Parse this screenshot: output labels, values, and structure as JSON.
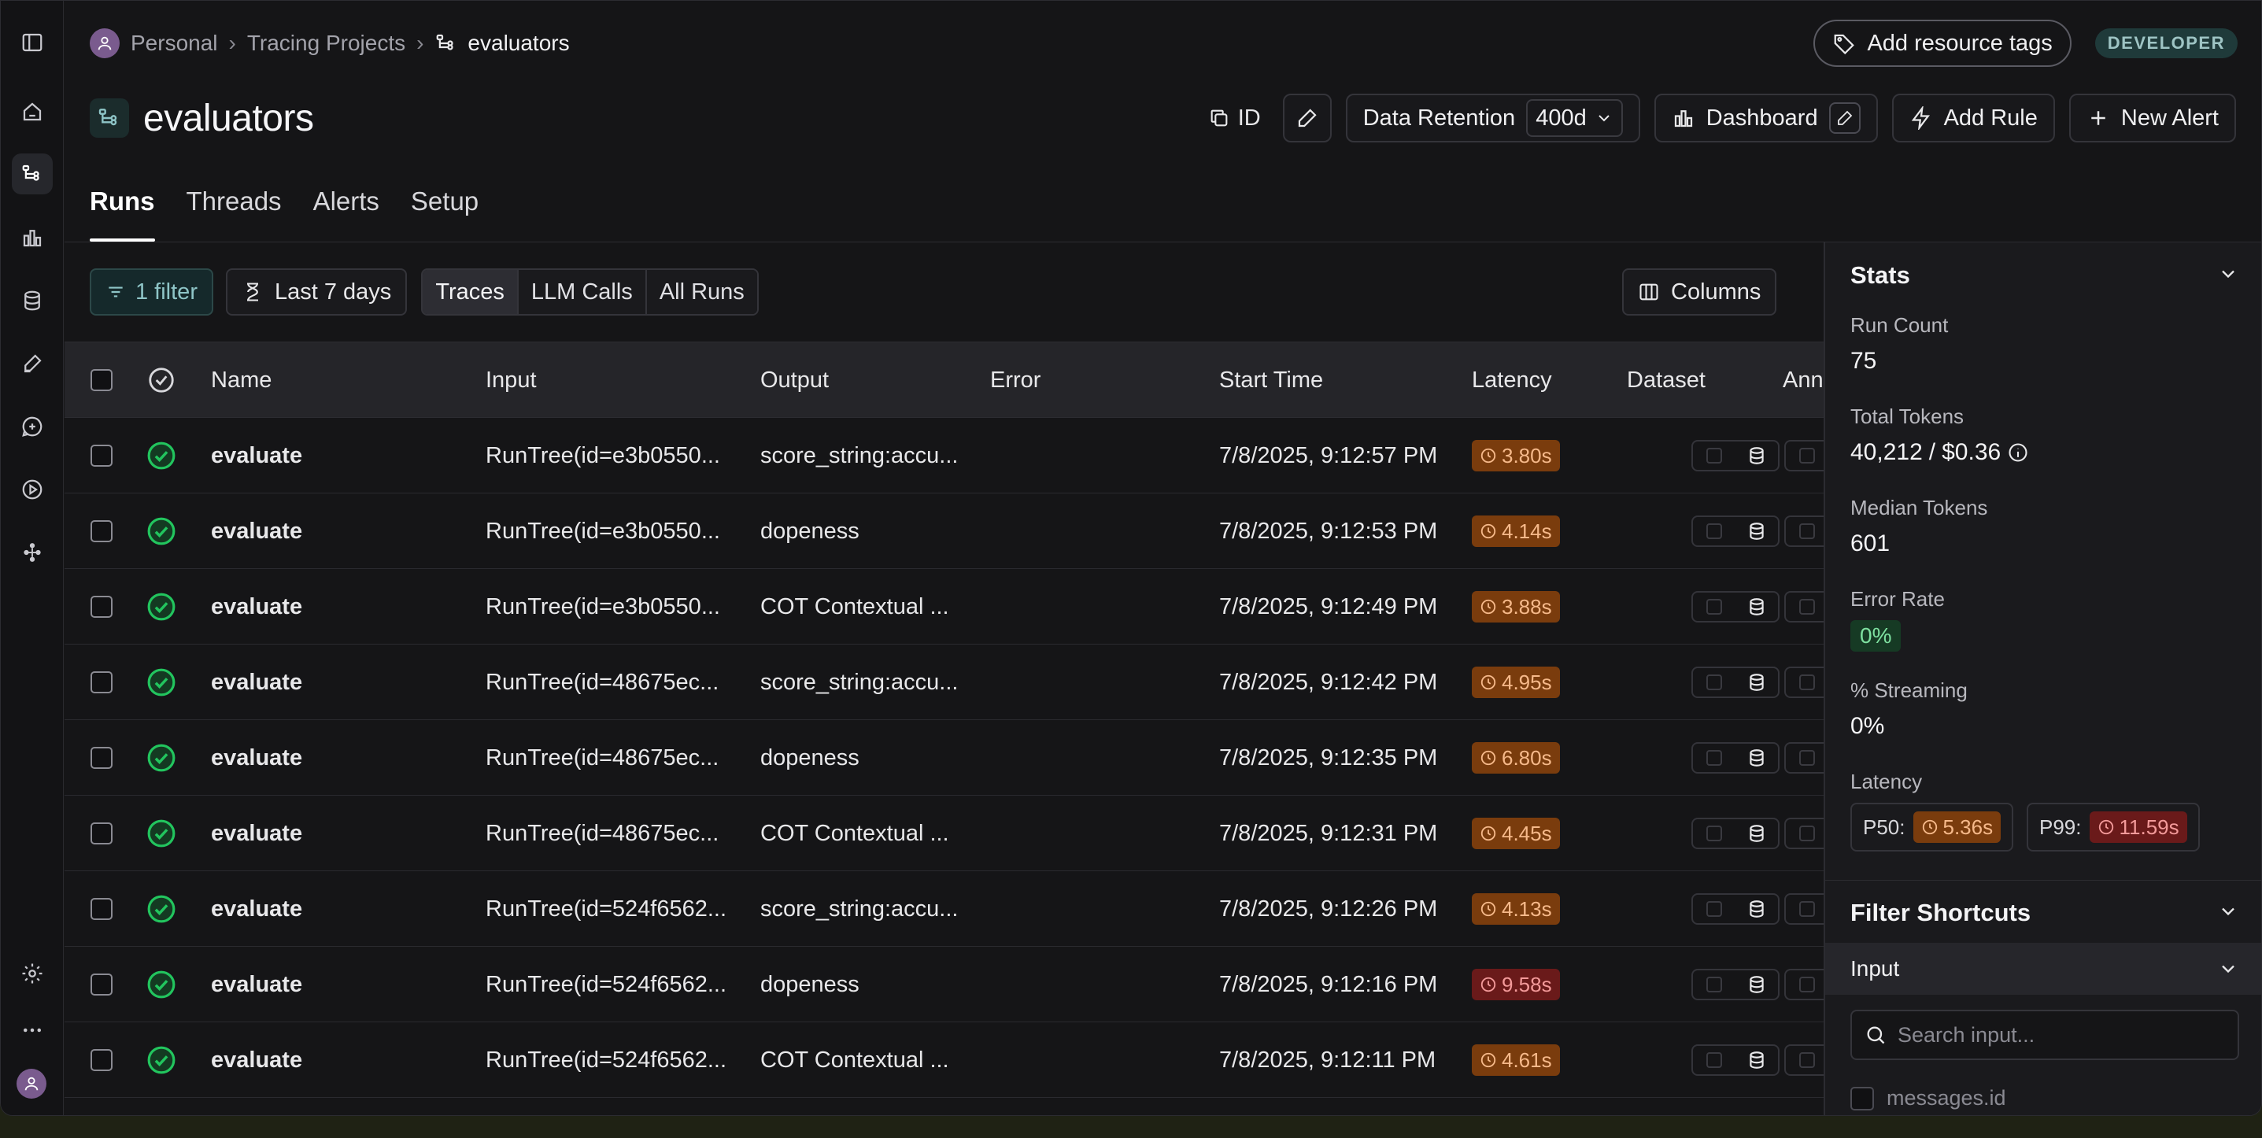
{
  "breadcrumb": {
    "items": [
      "Personal",
      "Tracing Projects"
    ],
    "current": "evaluators"
  },
  "header": {
    "add_tags_label": "Add resource tags",
    "env_badge": "DEVELOPER",
    "title": "evaluators",
    "id_label": "ID",
    "data_retention_label": "Data Retention",
    "data_retention_value": "400d",
    "dashboard_label": "Dashboard",
    "add_rule_label": "Add Rule",
    "new_alert_label": "New Alert"
  },
  "tabs": [
    {
      "label": "Runs",
      "active": true
    },
    {
      "label": "Threads",
      "active": false
    },
    {
      "label": "Alerts",
      "active": false
    },
    {
      "label": "Setup",
      "active": false
    }
  ],
  "toolbar": {
    "filter_label": "1 filter",
    "time_label": "Last 7 days",
    "views": [
      "Traces",
      "LLM Calls",
      "All Runs"
    ],
    "active_view": "Traces",
    "columns_label": "Columns"
  },
  "table": {
    "columns": [
      "Name",
      "Input",
      "Output",
      "Error",
      "Start Time",
      "Latency",
      "Dataset",
      "Ann"
    ],
    "rows": [
      {
        "name": "evaluate",
        "input": "RunTree(id=e3b0550...",
        "output": "score_string:accu...",
        "error": "",
        "start": "7/8/2025, 9:12:57 PM",
        "latency": "3.80s",
        "lat_level": "warn"
      },
      {
        "name": "evaluate",
        "input": "RunTree(id=e3b0550...",
        "output": "dopeness",
        "error": "",
        "start": "7/8/2025, 9:12:53 PM",
        "latency": "4.14s",
        "lat_level": "warn"
      },
      {
        "name": "evaluate",
        "input": "RunTree(id=e3b0550...",
        "output": "COT Contextual ...",
        "error": "",
        "start": "7/8/2025, 9:12:49 PM",
        "latency": "3.88s",
        "lat_level": "warn"
      },
      {
        "name": "evaluate",
        "input": "RunTree(id=48675ec...",
        "output": "score_string:accu...",
        "error": "",
        "start": "7/8/2025, 9:12:42 PM",
        "latency": "4.95s",
        "lat_level": "warn"
      },
      {
        "name": "evaluate",
        "input": "RunTree(id=48675ec...",
        "output": "dopeness",
        "error": "",
        "start": "7/8/2025, 9:12:35 PM",
        "latency": "6.80s",
        "lat_level": "warn"
      },
      {
        "name": "evaluate",
        "input": "RunTree(id=48675ec...",
        "output": "COT Contextual ...",
        "error": "",
        "start": "7/8/2025, 9:12:31 PM",
        "latency": "4.45s",
        "lat_level": "warn"
      },
      {
        "name": "evaluate",
        "input": "RunTree(id=524f6562...",
        "output": "score_string:accu...",
        "error": "",
        "start": "7/8/2025, 9:12:26 PM",
        "latency": "4.13s",
        "lat_level": "warn"
      },
      {
        "name": "evaluate",
        "input": "RunTree(id=524f6562...",
        "output": "dopeness",
        "error": "",
        "start": "7/8/2025, 9:12:16 PM",
        "latency": "9.58s",
        "lat_level": "error"
      },
      {
        "name": "evaluate",
        "input": "RunTree(id=524f6562...",
        "output": "COT Contextual ...",
        "error": "",
        "start": "7/8/2025, 9:12:11 PM",
        "latency": "4.61s",
        "lat_level": "warn"
      }
    ]
  },
  "stats": {
    "title": "Stats",
    "run_count_label": "Run Count",
    "run_count": "75",
    "total_tokens_label": "Total Tokens",
    "total_tokens": "40,212",
    "total_cost": "$0.36",
    "median_tokens_label": "Median Tokens",
    "median_tokens": "601",
    "error_rate_label": "Error Rate",
    "error_rate": "0%",
    "streaming_label": "% Streaming",
    "streaming": "0%",
    "latency_label": "Latency",
    "p50_label": "P50:",
    "p50": "5.36s",
    "p99_label": "P99:",
    "p99": "11.59s"
  },
  "filter_shortcuts": {
    "title": "Filter Shortcuts",
    "section": "Input",
    "search_placeholder": "Search input...",
    "options": [
      "messages.id"
    ]
  },
  "colors": {
    "accent_teal": "#8ec5c7",
    "latency_warn": "#7a3c0d",
    "latency_error": "#6a1a1a",
    "success": "#22c55e"
  }
}
